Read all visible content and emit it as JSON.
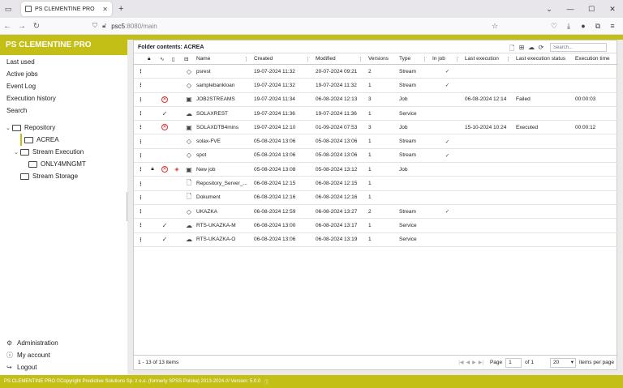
{
  "browser": {
    "tab_title": "PS CLEMENTINE PRO",
    "url_host": "psc5",
    "url_rest": ":8080/main"
  },
  "app": {
    "title": "PS CLEMENTINE PRO",
    "accent_color": "#c3bf17"
  },
  "sidebar": {
    "items": [
      "Last used",
      "Active jobs",
      "Event Log",
      "Execution history",
      "Search"
    ],
    "tree": {
      "repository": "Repository",
      "acrea": "ACREA",
      "stream_execution": "Stream Execution",
      "only4mngmt": "ONLY4MNGMT",
      "stream_storage": "Stream Storage"
    },
    "bottom": {
      "administration": "Administration",
      "my_account": "My account",
      "logout": "Logout"
    }
  },
  "main": {
    "folder_title": "Folder contents: ACREA",
    "search_placeholder": "Search...",
    "columns": {
      "name": "Name",
      "created": "Created",
      "modified": "Modified",
      "versions": "Versions",
      "type": "Type",
      "in_job": "In job",
      "last_execution": "Last execution",
      "last_execution_status": "Last execution status",
      "execution_time": "Execution time"
    },
    "rows": [
      {
        "lock": "",
        "err": "",
        "warn": "",
        "icon": "diamond",
        "name": "psrest",
        "created": "19-07-2024 11:32",
        "modified": "20-07-2024 09:21",
        "versions": "2",
        "type": "Stream",
        "in_job": "✓",
        "last_exec": "",
        "status": "",
        "time": ""
      },
      {
        "lock": "",
        "err": "",
        "warn": "",
        "icon": "diamond",
        "name": "samplebankloan",
        "created": "19-07-2024 11:32",
        "modified": "19-07-2024 11:32",
        "versions": "1",
        "type": "Stream",
        "in_job": "✓",
        "last_exec": "",
        "status": "",
        "time": ""
      },
      {
        "lock": "",
        "err": "⊗",
        "warn": "",
        "icon": "job",
        "name": "JOB2STREAMS",
        "created": "19-07-2024 11:34",
        "modified": "06-08-2024 12:13",
        "versions": "3",
        "type": "Job",
        "in_job": "",
        "last_exec": "06-08-2024 12:14",
        "status": "Failed",
        "time": "00:00:03"
      },
      {
        "lock": "",
        "err": "✓",
        "warn": "",
        "icon": "cloud",
        "name": "SOLAXREST",
        "created": "19-07-2024 11:36",
        "modified": "19-07-2024 11:36",
        "versions": "1",
        "type": "Service",
        "in_job": "",
        "last_exec": "",
        "status": "",
        "time": ""
      },
      {
        "lock": "",
        "err": "⊗",
        "warn": "",
        "icon": "job",
        "name": "SOLAXDTB4mins",
        "created": "19-07-2024 12:10",
        "modified": "01-09-2024 07:53",
        "versions": "3",
        "type": "Job",
        "in_job": "",
        "last_exec": "15-10-2024 10:24",
        "status": "Executed",
        "time": "00:00:12"
      },
      {
        "lock": "",
        "err": "",
        "warn": "",
        "icon": "diamond",
        "name": "solax-FVE",
        "created": "05-08-2024 13:06",
        "modified": "05-08-2024 13:06",
        "versions": "1",
        "type": "Stream",
        "in_job": "✓",
        "last_exec": "",
        "status": "",
        "time": ""
      },
      {
        "lock": "",
        "err": "",
        "warn": "",
        "icon": "diamond",
        "name": "spot",
        "created": "05-08-2024 13:06",
        "modified": "05-08-2024 13:06",
        "versions": "1",
        "type": "Stream",
        "in_job": "✓",
        "last_exec": "",
        "status": "",
        "time": ""
      },
      {
        "lock": "lock",
        "err": "⊗",
        "warn": "◇",
        "icon": "job",
        "name": "New job",
        "created": "05-08-2024 13:08",
        "modified": "05-08-2024 13:12",
        "versions": "1",
        "type": "Job",
        "in_job": "",
        "last_exec": "",
        "status": "",
        "time": ""
      },
      {
        "lock": "",
        "err": "",
        "warn": "",
        "icon": "doc",
        "name": "Repository_Server_...",
        "created": "06-08-2024 12:15",
        "modified": "06-08-2024 12:15",
        "versions": "1",
        "type": "",
        "in_job": "",
        "last_exec": "",
        "status": "",
        "time": ""
      },
      {
        "lock": "",
        "err": "",
        "warn": "",
        "icon": "doc",
        "name": "Dokument",
        "created": "06-08-2024 12:16",
        "modified": "06-08-2024 12:16",
        "versions": "1",
        "type": "",
        "in_job": "",
        "last_exec": "",
        "status": "",
        "time": ""
      },
      {
        "lock": "",
        "err": "",
        "warn": "",
        "icon": "diamond",
        "name": "UKAZKA",
        "created": "06-08-2024 12:59",
        "modified": "06-08-2024 13:27",
        "versions": "2",
        "type": "Stream",
        "in_job": "✓",
        "last_exec": "",
        "status": "",
        "time": ""
      },
      {
        "lock": "",
        "err": "✓",
        "warn": "",
        "icon": "cloud",
        "name": "RTS-UKAZKA-M",
        "created": "06-08-2024 13:00",
        "modified": "06-08-2024 13:17",
        "versions": "1",
        "type": "Service",
        "in_job": "",
        "last_exec": "",
        "status": "",
        "time": ""
      },
      {
        "lock": "",
        "err": "✓",
        "warn": "",
        "icon": "cloud",
        "name": "RTS-UKAZKA-O",
        "created": "06-08-2024 13:06",
        "modified": "06-08-2024 13:19",
        "versions": "1",
        "type": "Service",
        "in_job": "",
        "last_exec": "",
        "status": "",
        "time": ""
      }
    ],
    "footer": {
      "count": "1 - 13 of 13 items",
      "page_label": "Page",
      "page_value": "1",
      "of_label": "of 1",
      "per_page_value": "20",
      "per_page_label": "items per page"
    }
  },
  "status_bar": "PS CLEMENTINE PRO ©Copyright Predictive Solutions Sp. z o.o. (formerly SPSS Polska) 2013-2024 /// Version: 5.0.0"
}
